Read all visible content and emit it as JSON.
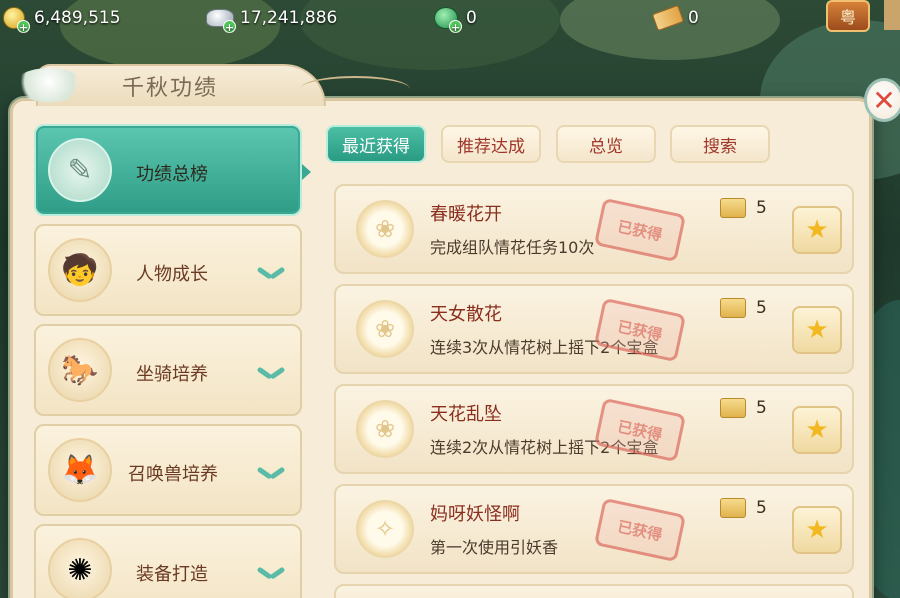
{
  "resources": [
    {
      "name": "gold",
      "value": "6,489,515",
      "icon": "gold-coin-icon"
    },
    {
      "name": "silver",
      "value": "17,241,886",
      "icon": "silver-ingot-icon"
    },
    {
      "name": "jade",
      "value": "0",
      "icon": "jade-coin-icon"
    },
    {
      "name": "ticket",
      "value": "0",
      "icon": "ticket-icon"
    }
  ],
  "top_right_badge": "粤",
  "panel": {
    "title": "千秋功绩",
    "close_icon": "close-icon"
  },
  "sidebar": {
    "items": [
      {
        "label": "功绩总榜",
        "icon": "scroll-icon",
        "active": true
      },
      {
        "label": "人物成长",
        "icon": "character-avatar-icon",
        "active": false
      },
      {
        "label": "坐骑培养",
        "icon": "mount-avatar-icon",
        "active": false
      },
      {
        "label": "召唤兽培养",
        "icon": "summon-beast-icon",
        "active": false
      },
      {
        "label": "装备打造",
        "icon": "equipment-icon",
        "active": false
      }
    ]
  },
  "tabs": [
    {
      "label": "最近获得",
      "active": true
    },
    {
      "label": "推荐达成",
      "active": false
    },
    {
      "label": "总览",
      "active": false
    },
    {
      "label": "搜索",
      "active": false
    }
  ],
  "achievements": [
    {
      "name": "春暖花开",
      "desc": "完成组队情花任务10次",
      "points": "5",
      "stamp": "已获得",
      "icon": "lotus-icon"
    },
    {
      "name": "天女散花",
      "desc": "连续3次从情花树上摇下2个宝盒",
      "points": "5",
      "stamp": "已获得",
      "icon": "lotus-icon"
    },
    {
      "name": "天花乱坠",
      "desc": "连续2次从情花树上摇下2个宝盒",
      "points": "5",
      "stamp": "已获得",
      "icon": "lotus-icon"
    },
    {
      "name": "妈呀妖怪啊",
      "desc": "第一次使用引妖香",
      "points": "5",
      "stamp": "已获得",
      "icon": "demon-icon"
    }
  ],
  "colors": {
    "accent_teal": "#2e9c86",
    "title_red": "#8a2e1e",
    "panel_bg": "#f6ecd8"
  }
}
